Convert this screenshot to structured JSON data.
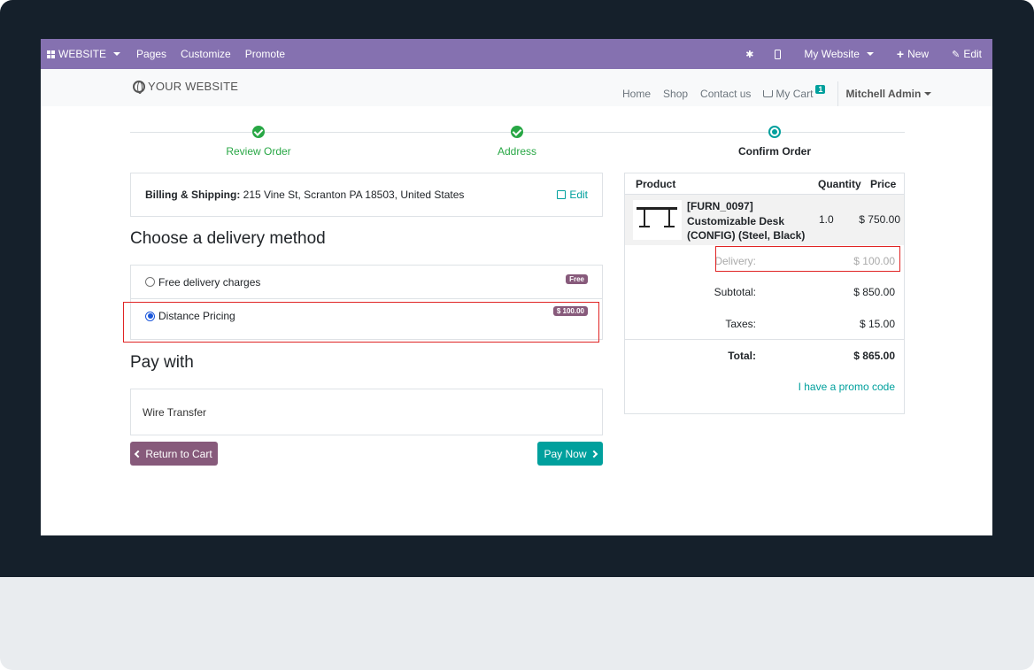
{
  "admin_bar": {
    "website_label": "WEBSITE",
    "pages": "Pages",
    "customize": "Customize",
    "promote": "Promote",
    "my_website": "My Website",
    "new": "New",
    "edit": "Edit"
  },
  "header": {
    "brand": "YOUR WEBSITE",
    "nav": [
      "Home",
      "Shop",
      "Contact us"
    ],
    "cart_label": "My Cart",
    "cart_count": "1",
    "user": "Mitchell Admin"
  },
  "wizard": {
    "steps": [
      {
        "label": "Review Order",
        "state": "done"
      },
      {
        "label": "Address",
        "state": "done"
      },
      {
        "label": "Confirm Order",
        "state": "current"
      }
    ]
  },
  "billing": {
    "label": "Billing & Shipping:",
    "address": " 215 Vine St, Scranton PA 18503, United States",
    "edit": "Edit"
  },
  "delivery": {
    "heading": "Choose a delivery method",
    "options": [
      {
        "label": "Free delivery charges",
        "price": "Free",
        "selected": false
      },
      {
        "label": "Distance Pricing",
        "price": "$ 100.00",
        "selected": true
      }
    ]
  },
  "payment": {
    "heading": "Pay with",
    "method": "Wire Transfer",
    "return_label": "Return to Cart",
    "pay_label": "Pay Now"
  },
  "summary": {
    "col_product": "Product",
    "col_quantity": "Quantity",
    "col_price": "Price",
    "product_name": "[FURN_0097] Customizable Desk (CONFIG) (Steel, Black)",
    "quantity": "1.0",
    "price": "$ 750.00",
    "delivery_label": "Delivery:",
    "delivery_value": "$ 100.00",
    "subtotal_label": "Subtotal:",
    "subtotal_value": "$ 850.00",
    "taxes_label": "Taxes:",
    "taxes_value": "$ 15.00",
    "total_label": "Total:",
    "total_value": "$ 865.00",
    "promo": "I have a promo code"
  },
  "colors": {
    "admin_bar": "#8571b0",
    "primary": "#875a7b",
    "accent": "#00a09d",
    "success": "#28a745",
    "highlight": "#e02424"
  }
}
